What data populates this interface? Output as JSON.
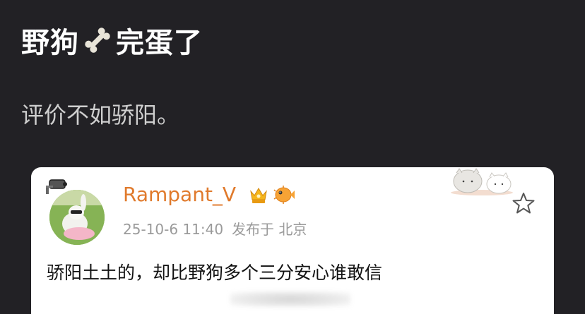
{
  "post": {
    "title_part1": "野狗",
    "title_part2": "完蛋了",
    "bone_icon": "bone-icon",
    "body": "评价不如骄阳。"
  },
  "comment_card": {
    "username": "Rampant_V",
    "badges": [
      "crown-badge-icon",
      "pufferfish-badge-icon"
    ],
    "timestamp": "25-10-6 11:40",
    "location": "发布于 北京",
    "text": "骄阳土土的，却比野狗多个三分安心谁敢信",
    "colors": {
      "username": "#e07a2c",
      "meta": "#9a9a9a",
      "background": "#ffffff"
    }
  },
  "colors": {
    "page_background": "#222125",
    "title": "#ffffff",
    "body": "#cfcfcf"
  }
}
